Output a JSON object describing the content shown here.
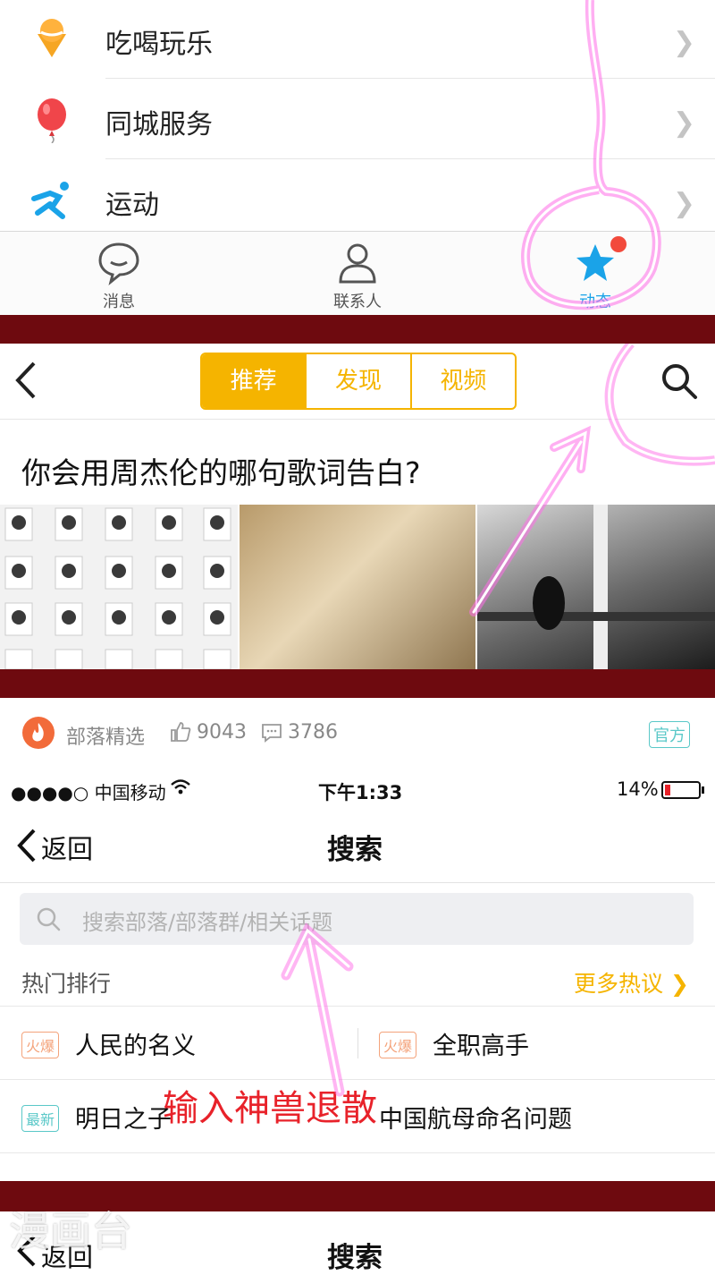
{
  "panel1": {
    "menu": [
      {
        "label": "吃喝玩乐",
        "icon": "ice-cream-icon"
      },
      {
        "label": "同城服务",
        "icon": "balloon-icon"
      },
      {
        "label": "运动",
        "icon": "runner-icon"
      }
    ],
    "tabs": [
      {
        "label": "消息",
        "icon": "chat-bubble-icon"
      },
      {
        "label": "联系人",
        "icon": "contact-person-icon"
      },
      {
        "label": "动态",
        "icon": "star-icon"
      }
    ],
    "colors": {
      "accent": "#1aa3e8",
      "chevron": "#c4c4c4",
      "badge": "#f24a3c"
    }
  },
  "panel2": {
    "back_icon": "back-chevron-icon",
    "segments": [
      "推荐",
      "发现",
      "视频"
    ],
    "search_icon": "search-icon",
    "title": "你会用周杰伦的哪句歌词告白?",
    "colors": {
      "segment": "#f5b400"
    }
  },
  "panel3": {
    "source": "部落精选",
    "likes": "9043",
    "comments": "3786",
    "official_badge": "官方",
    "status": {
      "carrier": "●●●●○ 中国移动",
      "time": "下午1:33",
      "battery": "14%"
    },
    "nav": {
      "back": "返回",
      "title": "搜索"
    },
    "search_placeholder": "搜索部落/部落群/相关话题",
    "section_title": "热门排行",
    "more": "更多热议",
    "rows": [
      [
        {
          "badge": "火爆",
          "text": "人民的名义"
        },
        {
          "badge": "火爆",
          "text": "全职高手"
        }
      ],
      [
        {
          "badge": "最新",
          "text": "明日之子"
        },
        {
          "badge": "",
          "text": "中国航母命名问题"
        }
      ]
    ],
    "annotation": "输入神兽退散",
    "colors": {
      "hot": "#f4a37b",
      "new": "#5ac8c8",
      "more": "#f5b400",
      "annotation": "#e8222a"
    }
  },
  "panel4": {
    "nav": {
      "back": "返回",
      "title": "搜索"
    }
  },
  "watermark": "漫画台"
}
